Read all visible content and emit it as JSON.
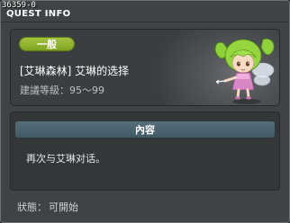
{
  "window": {
    "quest_id": "36359-0",
    "title": "QUEST INFO"
  },
  "quest": {
    "badge": "一般",
    "name": "[艾琳森林] 艾琳的选择",
    "level_label": "建議等級：",
    "level_range": "95～99"
  },
  "content": {
    "header": "內容",
    "text": "再次与艾琳对话。"
  },
  "status": {
    "label": "狀態：",
    "value": "可開始"
  },
  "npc": {
    "icon": "fairy-npc-icon"
  },
  "colors": {
    "badge_green": "#8db52b",
    "panel_bg": "#404345",
    "content_header": "#4c6470"
  }
}
